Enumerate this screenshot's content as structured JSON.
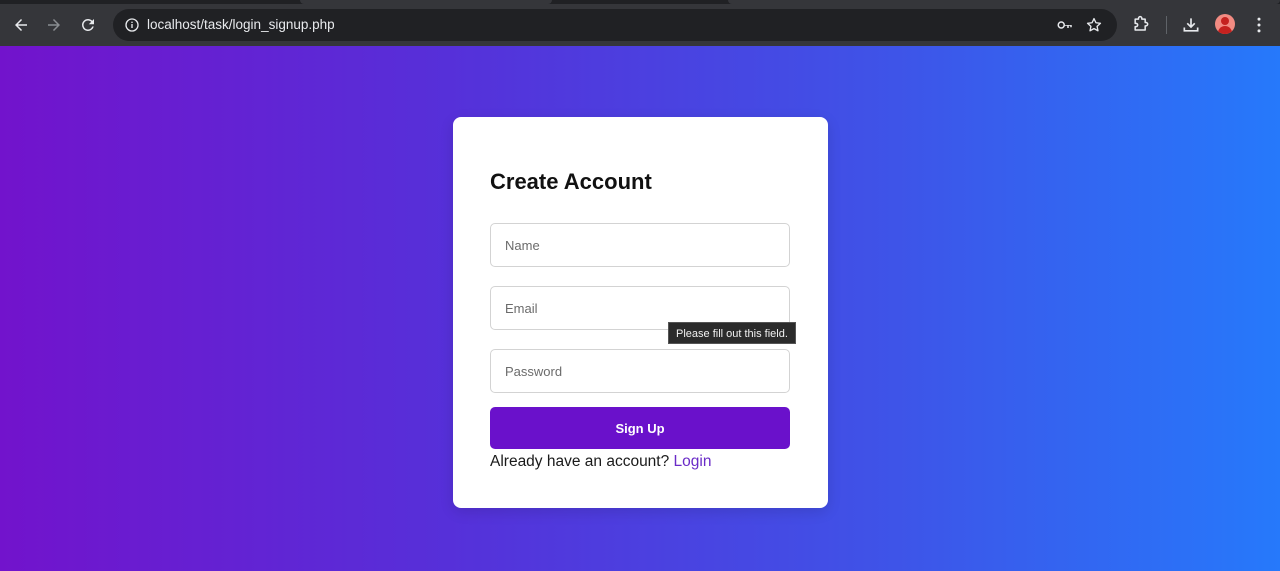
{
  "browser": {
    "url": "localhost/task/login_signup.php",
    "icons": {
      "back": "arrow-left-icon",
      "forward": "arrow-right-icon",
      "reload": "reload-icon",
      "site_info": "info-icon",
      "password": "key-icon",
      "bookmark": "star-icon",
      "extensions": "puzzle-icon",
      "downloads": "download-icon",
      "profile": "avatar",
      "menu": "kebab-menu-icon"
    },
    "colors": {
      "chrome_bg": "#35363a",
      "omnibox_bg": "#202124",
      "icon_color": "#e8eaed"
    }
  },
  "page": {
    "background_gradient": [
      "#7213cc",
      "#2679fb"
    ],
    "form": {
      "title": "Create Account",
      "name_placeholder": "Name",
      "email_placeholder": "Email",
      "password_placeholder": "Password",
      "submit_label": "Sign Up",
      "submit_color": "#6a11cb",
      "login_prompt": "Already have an account?",
      "login_link": "Login",
      "login_link_color": "#6a2bc7"
    },
    "validation_tooltip": "Please fill out this field."
  }
}
